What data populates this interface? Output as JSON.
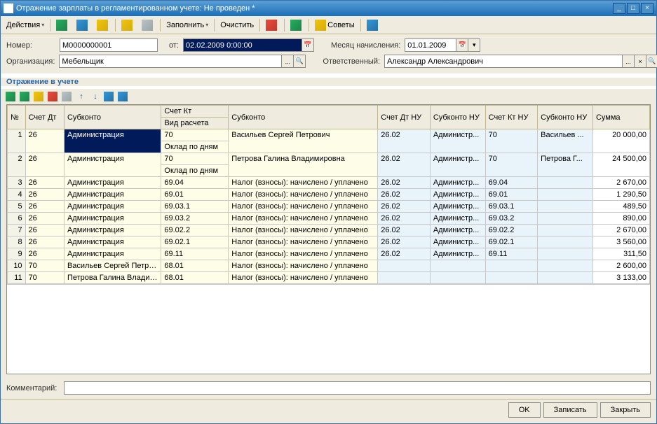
{
  "window": {
    "title": "Отражение зарплаты в регламентированном учете: Не проведен *"
  },
  "toolbar": {
    "actions": "Действия",
    "fill": "Заполнить",
    "clear": "Очистить",
    "tips": "Советы"
  },
  "form": {
    "number_label": "Номер:",
    "number_value": "М0000000001",
    "from_label": "от:",
    "from_value": "02.02.2009 0:00:00",
    "month_label": "Месяц начисления:",
    "month_value": "01.01.2009",
    "org_label": "Организация:",
    "org_value": "Мебельщик",
    "resp_label": "Ответственный:",
    "resp_value": "Александр Александрович"
  },
  "section": "Отражение в учете",
  "headers": {
    "n": "№",
    "schetDt": "Счет Дт",
    "subkonto": "Субконто",
    "schetKt": "Счет Кт",
    "vidRascheta": "Вид расчета",
    "subkonto2": "Субконто",
    "schetDtNU": "Счет Дт НУ",
    "subkontoNU": "Субконто НУ",
    "schetKtNU": "Счет Кт НУ",
    "subkontoNU2": "Субконто НУ",
    "summa": "Сумма"
  },
  "rows": [
    {
      "n": "1",
      "dt": "26",
      "sub": "Администрация",
      "kt": "70",
      "vid": "Оклад по дням",
      "sub2": "Васильев Сергей Петрович",
      "dtNU": "26.02",
      "subNU": "Администр...",
      "ktNU": "70",
      "subNU2": "Васильев ...",
      "sum": "20 000,00"
    },
    {
      "n": "2",
      "dt": "26",
      "sub": "Администрация",
      "kt": "70",
      "vid": "Оклад по дням",
      "sub2": "Петрова Галина Владимировна",
      "dtNU": "26.02",
      "subNU": "Администр...",
      "ktNU": "70",
      "subNU2": "Петрова Г...",
      "sum": "24 500,00"
    },
    {
      "n": "3",
      "dt": "26",
      "sub": "Администрация",
      "kt": "69.04",
      "vid": "",
      "sub2": "Налог (взносы): начислено / уплачено",
      "dtNU": "26.02",
      "subNU": "Администр...",
      "ktNU": "69.04",
      "subNU2": "",
      "sum": "2 670,00"
    },
    {
      "n": "4",
      "dt": "26",
      "sub": "Администрация",
      "kt": "69.01",
      "vid": "",
      "sub2": "Налог (взносы): начислено / уплачено",
      "dtNU": "26.02",
      "subNU": "Администр...",
      "ktNU": "69.01",
      "subNU2": "",
      "sum": "1 290,50"
    },
    {
      "n": "5",
      "dt": "26",
      "sub": "Администрация",
      "kt": "69.03.1",
      "vid": "",
      "sub2": "Налог (взносы): начислено / уплачено",
      "dtNU": "26.02",
      "subNU": "Администр...",
      "ktNU": "69.03.1",
      "subNU2": "",
      "sum": "489,50"
    },
    {
      "n": "6",
      "dt": "26",
      "sub": "Администрация",
      "kt": "69.03.2",
      "vid": "",
      "sub2": "Налог (взносы): начислено / уплачено",
      "dtNU": "26.02",
      "subNU": "Администр...",
      "ktNU": "69.03.2",
      "subNU2": "",
      "sum": "890,00"
    },
    {
      "n": "7",
      "dt": "26",
      "sub": "Администрация",
      "kt": "69.02.2",
      "vid": "",
      "sub2": "Налог (взносы): начислено / уплачено",
      "dtNU": "26.02",
      "subNU": "Администр...",
      "ktNU": "69.02.2",
      "subNU2": "",
      "sum": "2 670,00"
    },
    {
      "n": "8",
      "dt": "26",
      "sub": "Администрация",
      "kt": "69.02.1",
      "vid": "",
      "sub2": "Налог (взносы): начислено / уплачено",
      "dtNU": "26.02",
      "subNU": "Администр...",
      "ktNU": "69.02.1",
      "subNU2": "",
      "sum": "3 560,00"
    },
    {
      "n": "9",
      "dt": "26",
      "sub": "Администрация",
      "kt": "69.11",
      "vid": "",
      "sub2": "Налог (взносы): начислено / уплачено",
      "dtNU": "26.02",
      "subNU": "Администр...",
      "ktNU": "69.11",
      "subNU2": "",
      "sum": "311,50"
    },
    {
      "n": "10",
      "dt": "70",
      "sub": "Васильев Сергей Петров...",
      "kt": "68.01",
      "vid": "",
      "sub2": "Налог (взносы): начислено / уплачено",
      "dtNU": "",
      "subNU": "",
      "ktNU": "",
      "subNU2": "",
      "sum": "2 600,00"
    },
    {
      "n": "11",
      "dt": "70",
      "sub": "Петрова Галина Владим...",
      "kt": "68.01",
      "vid": "",
      "sub2": "Налог (взносы): начислено / уплачено",
      "dtNU": "",
      "subNU": "",
      "ktNU": "",
      "subNU2": "",
      "sum": "3 133,00"
    }
  ],
  "footer": {
    "comment_label": "Комментарий:",
    "comment_value": "",
    "ok": "OK",
    "write": "Записать",
    "close": "Закрыть"
  }
}
